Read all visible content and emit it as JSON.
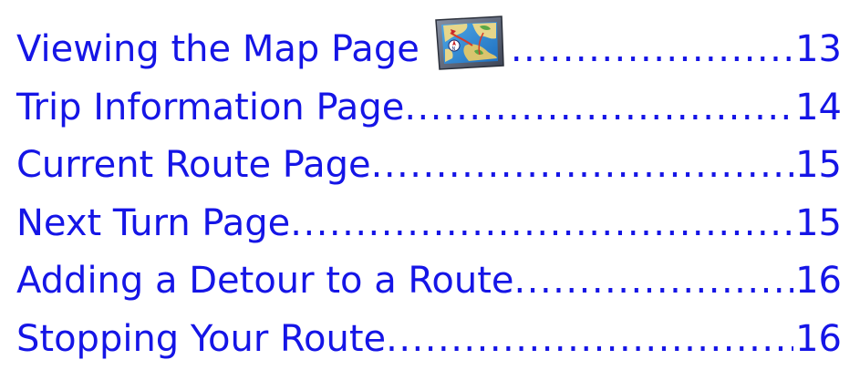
{
  "toc": {
    "entries": [
      {
        "title": "Viewing the Map Page",
        "page": "13",
        "icon": "map-icon"
      },
      {
        "title": "Trip Information Page",
        "page": "14"
      },
      {
        "title": "Current Route Page",
        "page": "15"
      },
      {
        "title": "Next Turn Page",
        "page": "15"
      },
      {
        "title": "Adding a Detour to a Route",
        "page": "16"
      },
      {
        "title": "Stopping Your Route",
        "page": "16"
      }
    ]
  },
  "colors": {
    "link_text": "#1515e6",
    "background": "#ffffff"
  }
}
